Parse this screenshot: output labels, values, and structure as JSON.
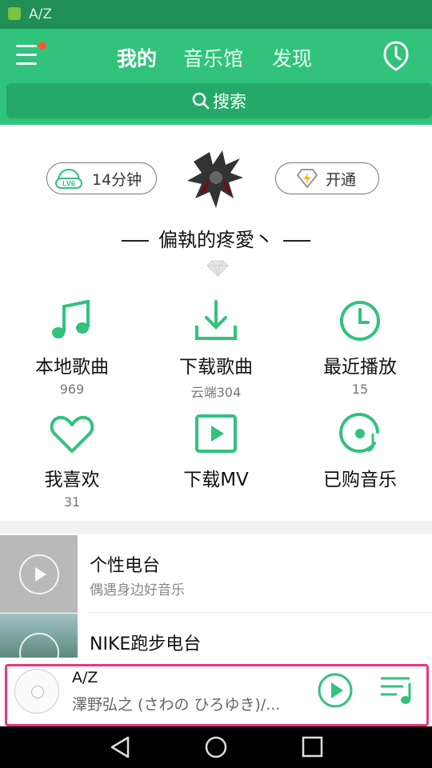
{
  "status_bar": {
    "title": "A/Z"
  },
  "header": {
    "tabs": [
      {
        "label": "我的",
        "active": true
      },
      {
        "label": "音乐馆",
        "active": false
      },
      {
        "label": "发现",
        "active": false
      }
    ],
    "search_label": "搜索"
  },
  "profile": {
    "level_badge": "LV6",
    "listen_time": "14分钟",
    "vip_label": "开通",
    "username": "偏執的疼愛丶"
  },
  "grid": [
    {
      "icon": "music-note-icon",
      "label": "本地歌曲",
      "count": "969"
    },
    {
      "icon": "download-icon",
      "label": "下载歌曲",
      "count": "云端304"
    },
    {
      "icon": "clock-icon",
      "label": "最近播放",
      "count": "15"
    },
    {
      "icon": "heart-icon",
      "label": "我喜欢",
      "count": "31"
    },
    {
      "icon": "mv-play-icon",
      "label": "下载MV",
      "count": ""
    },
    {
      "icon": "purchased-music-icon",
      "label": "已购音乐",
      "count": ""
    }
  ],
  "radios": [
    {
      "title": "个性电台",
      "subtitle": "偶遇身边好音乐"
    },
    {
      "title": "NIKE跑步电台",
      "subtitle": ""
    }
  ],
  "player": {
    "title": "A/Z",
    "artist": "澤野弘之 (さわの ひろゆき)/..."
  },
  "colors": {
    "brand": "#31c27c",
    "status_bar": "#1f8f55",
    "highlight": "#e83680"
  }
}
